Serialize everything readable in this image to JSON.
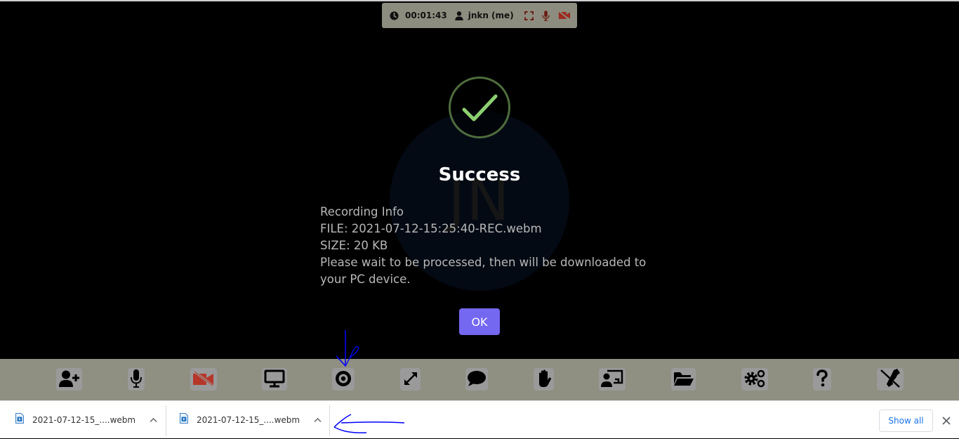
{
  "status_bar": {
    "timer": "00:01:43",
    "username": "jnkn (me)",
    "icons": [
      "clock-icon",
      "user-icon",
      "fullscreen-icon",
      "microphone-icon",
      "video-off-icon"
    ]
  },
  "avatar": {
    "initials": "JN"
  },
  "dialog": {
    "icon": "success-check-icon",
    "title": "Success",
    "lines": [
      "Recording Info",
      "FILE: 2021-07-12-15:25:40-REC.webm",
      "SIZE: 20 KB",
      "Please wait to be processed, then will be downloaded to your PC device."
    ],
    "ok_label": "OK"
  },
  "toolbar": {
    "buttons": [
      {
        "name": "add-participant",
        "icon": "user-plus-icon"
      },
      {
        "name": "microphone",
        "icon": "microphone-icon"
      },
      {
        "name": "video",
        "icon": "video-off-icon",
        "state": "off"
      },
      {
        "name": "share-screen",
        "icon": "desktop-icon"
      },
      {
        "name": "record",
        "icon": "record-icon"
      },
      {
        "name": "fullscreen",
        "icon": "expand-icon"
      },
      {
        "name": "chat",
        "icon": "chat-bubble-icon"
      },
      {
        "name": "raise-hand",
        "icon": "hand-icon"
      },
      {
        "name": "whiteboard",
        "icon": "presentation-icon"
      },
      {
        "name": "file-sharing",
        "icon": "folder-open-icon"
      },
      {
        "name": "settings",
        "icon": "cogs-icon"
      },
      {
        "name": "help",
        "icon": "question-icon"
      },
      {
        "name": "leave",
        "icon": "phone-hangup-icon"
      }
    ]
  },
  "downloads": {
    "items": [
      {
        "filename": "2021-07-12-15_....webm"
      },
      {
        "filename": "2021-07-12-15_....webm"
      }
    ],
    "show_all_label": "Show all"
  },
  "colors": {
    "accent": "#7467f0",
    "toolbar_bg": "#8f8f82",
    "video_off": "#b5372a",
    "success": "#8cd071",
    "annotation": "#0000ff",
    "link_blue": "#1a73e8"
  }
}
